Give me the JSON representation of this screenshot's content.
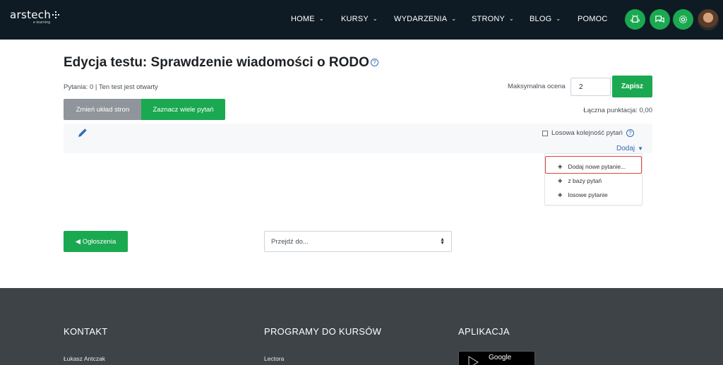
{
  "nav": {
    "logo": "arstech",
    "logo_sub": "e-learning",
    "items": [
      {
        "label": "HOME",
        "chevron": true
      },
      {
        "label": "KURSY",
        "chevron": true
      },
      {
        "label": "WYDARZENIA",
        "chevron": true
      },
      {
        "label": "STRONY",
        "chevron": true
      },
      {
        "label": "BLOG",
        "chevron": true
      },
      {
        "label": "POMOC",
        "chevron": false
      }
    ],
    "icon_buttons": [
      "android-icon",
      "chat-icon",
      "settings-icon"
    ],
    "accent": "#1aa950"
  },
  "page": {
    "title": "Edycja testu: Sprawdzenie wiadomości o RODO",
    "status": "Pytania: 0 | Ten test jest otwarty",
    "max_grade_label": "Maksymalna ocena",
    "max_grade_value": "2",
    "save_label": "Zapisz",
    "total_points": "Łączna punktacja: 0,00",
    "repaginate_label": "Zmień układ stron",
    "select_multiple_label": "Zaznacz wiele pytań",
    "shuffle_label": "Losowa kolejność pytań",
    "add_label": "Dodaj",
    "add_menu": [
      "Dodaj nowe pytanie...",
      "z bazy pytań",
      "losowe pytanie"
    ],
    "announcements_label": "◀ Ogłoszenia",
    "jump_placeholder": "Przejdź do..."
  },
  "footer": {
    "contact_heading": "KONTAKT",
    "contact_name": "Łukasz Antczak",
    "programs_heading": "PROGRAMY DO KURSÓW",
    "programs_item": "Lectora",
    "apps_heading": "APLIKACJA",
    "store_label": "Google"
  }
}
